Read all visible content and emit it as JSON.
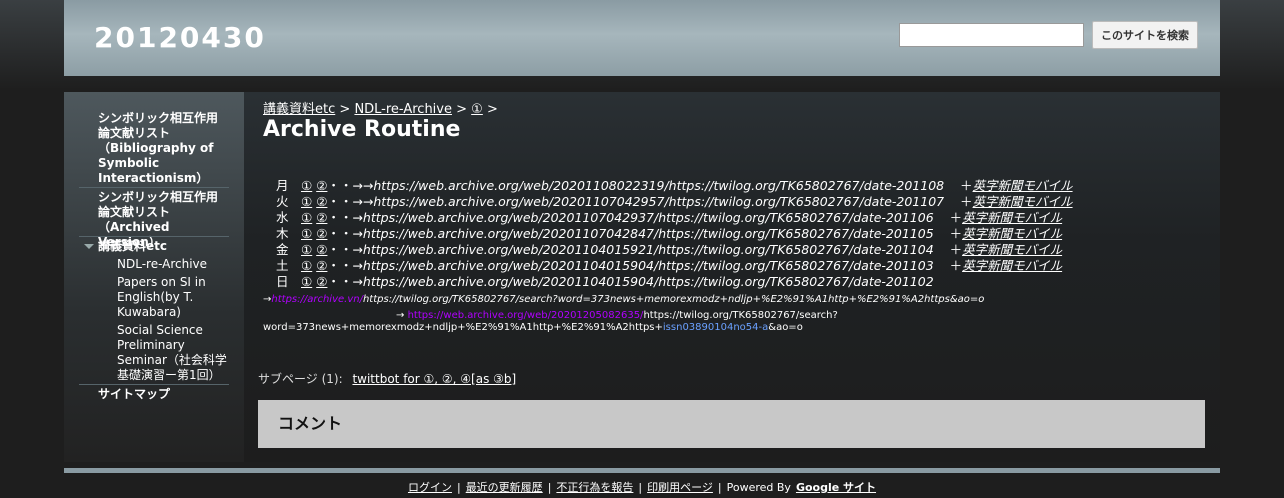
{
  "site": {
    "title": "20120430"
  },
  "search": {
    "placeholder": "",
    "button_label": "このサイトを検索"
  },
  "sidebar": {
    "items": [
      {
        "label": "シンボリック相互作用論文献リスト（Bibliography of Symbolic Interactionism）"
      },
      {
        "label": "シンボリック相互作用論文献リスト（Archived Version）"
      },
      {
        "label": "講義資料etc"
      },
      {
        "label": "NDL-re-Archive"
      },
      {
        "label": "Papers on SI in English(by T. Kuwabara)"
      },
      {
        "label": "Social Science Preliminary Seminar（社会科学基礎演習ー第1回）"
      },
      {
        "label": "サイトマップ"
      }
    ]
  },
  "breadcrumb": {
    "items": [
      "講義資料etc",
      "NDL-re-Archive",
      "①"
    ],
    "sep": ">"
  },
  "page": {
    "title": "Archive Routine"
  },
  "week": [
    {
      "day": "月",
      "l1": "①",
      "l2": "②",
      "mid": "・・→→",
      "url": "https://web.archive.org/web/20201108022319/https://twilog.org/TK65802767/date-201108",
      "plus": "＋",
      "mobile": "英字新聞モバイル"
    },
    {
      "day": "火",
      "l1": "①",
      "l2": "②",
      "mid": "・・→→",
      "url": "https://web.archive.org/web/20201107042957/https://twilog.org/TK65802767/date-201107",
      "plus": "＋",
      "mobile": "英字新聞モバイル"
    },
    {
      "day": "水",
      "l1": "①",
      "l2": "②",
      "mid": "・・→",
      "url": "https://web.archive.org/web/20201107042937/https://twilog.org/TK65802767/date-201106",
      "plus": "＋",
      "mobile": "英字新聞モバイル"
    },
    {
      "day": "木",
      "l1": "①",
      "l2": "②",
      "mid": "・・→",
      "url": "https://web.archive.org/web/20201107042847/https://twilog.org/TK65802767/date-201105",
      "plus": "＋",
      "mobile": "英字新聞モバイル"
    },
    {
      "day": "金",
      "l1": "①",
      "l2": "②",
      "mid": "・・→",
      "url": "https://web.archive.org/web/20201104015921/https://twilog.org/TK65802767/date-201104",
      "plus": "＋",
      "mobile": "英字新聞モバイル"
    },
    {
      "day": "土",
      "l1": "①",
      "l2": "②",
      "mid": "・・→",
      "url": "https://web.archive.org/web/20201104015904/https://twilog.org/TK65802767/date-201103",
      "plus": "＋",
      "mobile": "英字新聞モバイル"
    },
    {
      "day": "日",
      "l1": "①",
      "l2": "②",
      "mid": "・・→",
      "url": "https://web.archive.org/web/20201104015904/https://twilog.org/TK65802767/date-201102",
      "plus": "",
      "mobile": ""
    }
  ],
  "extra": {
    "line1_arrow": "→",
    "line1_link": "https://archive.vn/",
    "line1_rest": "https://twilog.org/TK65802767/search?word=373news+memorexmodz+ndljp+%E2%91%A1http+%E2%91%A2https&ao=o",
    "line2_arrow": "→",
    "line2_link": "https://web.archive.org/web/20201205082635/",
    "line2_rest": "https://twilog.org/TK65802767/search?",
    "line3_text": "word=373news+memorexmodz+ndljp+%E2%91%A1http+%E2%91%A2https+",
    "line3_link": "issn03890104no54-a",
    "line3_end": "&ao=o"
  },
  "subpages": {
    "label": "サブページ (1):",
    "link": "twittbot for ①, ②, ④[as ③b]"
  },
  "comments": {
    "title": "コメント"
  },
  "footer": {
    "links": [
      "ログイン",
      "最近の更新履歴",
      "不正行為を報告",
      "印刷用ページ"
    ],
    "powered": "Powered By",
    "google": "Google サイト"
  },
  "colors": {
    "header": "#a6b6bc",
    "purple_link": "#b000ff",
    "blue_link": "#6aa0ff",
    "comment_bg": "#c8c8c8"
  }
}
